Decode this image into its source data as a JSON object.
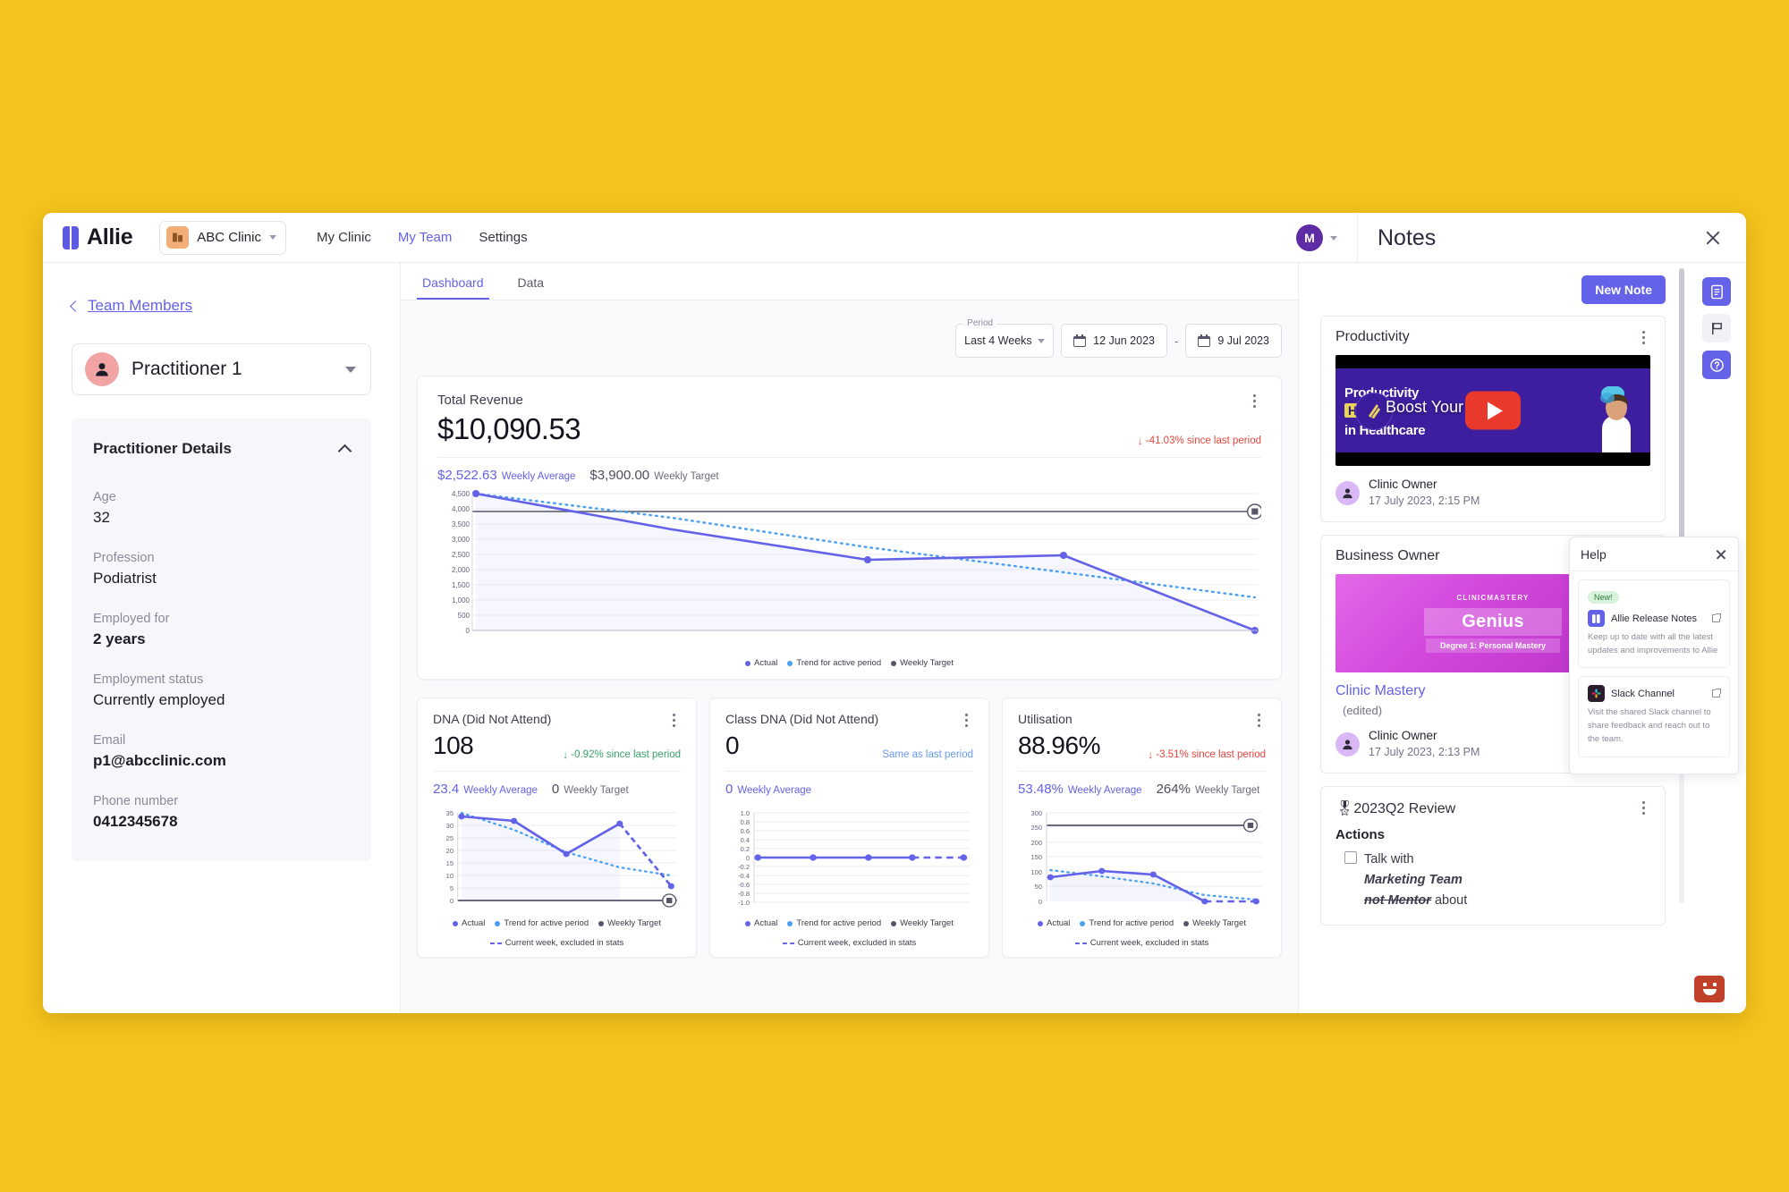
{
  "brand": {
    "name": "Allie",
    "accent": "#6462E8"
  },
  "topbar": {
    "clinic_name": "ABC Clinic",
    "nav": [
      {
        "label": "My Clinic",
        "active": false
      },
      {
        "label": "My Team",
        "active": true
      },
      {
        "label": "Settings",
        "active": false
      }
    ],
    "avatar_initial": "M"
  },
  "left_panel": {
    "breadcrumb": "Team Members",
    "practitioner": "Practitioner 1",
    "details_title": "Practitioner Details",
    "fields": [
      {
        "label": "Age",
        "value": "32",
        "bold": false
      },
      {
        "label": "Profession",
        "value": "Podiatrist",
        "bold": false
      },
      {
        "label": "Employed for",
        "value": "2 years",
        "bold": true
      },
      {
        "label": "Employment status",
        "value": "Currently employed",
        "bold": false
      },
      {
        "label": "Email",
        "value": "p1@abcclinic.com",
        "bold": true
      },
      {
        "label": "Phone number",
        "value": "0412345678",
        "bold": true
      }
    ]
  },
  "center": {
    "tabs": [
      {
        "label": "Dashboard",
        "active": true
      },
      {
        "label": "Data",
        "active": false
      }
    ],
    "period_legend": "Period",
    "period_value": "Last 4 Weeks",
    "date_from": "12 Jun 2023",
    "date_to": "9 Jul 2023",
    "date_sep": "-",
    "revenue": {
      "title": "Total Revenue",
      "value": "$10,090.53",
      "delta": "-41.03% since last period",
      "delta_dir": "down",
      "weekly_average_value": "$2,522.63",
      "weekly_average_label": "Weekly Average",
      "weekly_target_value": "$3,900.00",
      "weekly_target_label": "Weekly Target"
    },
    "cards": [
      {
        "title": "DNA (Did Not Attend)",
        "value": "108",
        "delta": "-0.92% since last period",
        "delta_dir": "good",
        "weekly_average_value": "23.4",
        "weekly_average_label": "Weekly Average",
        "weekly_target_value": "0",
        "weekly_target_label": "Weekly Target"
      },
      {
        "title": "Class DNA (Did Not Attend)",
        "value": "0",
        "delta": "Same as last period",
        "delta_dir": "same",
        "weekly_average_value": "0",
        "weekly_average_label": "Weekly Average",
        "weekly_target_value": "",
        "weekly_target_label": ""
      },
      {
        "title": "Utilisation",
        "value": "88.96%",
        "delta": "-3.51% since last period",
        "delta_dir": "down",
        "weekly_average_value": "53.48%",
        "weekly_average_label": "Weekly Average",
        "weekly_target_value": "264%",
        "weekly_target_label": "Weekly Target"
      }
    ],
    "legend": {
      "actual": "Actual",
      "trend": "Trend for active period",
      "target": "Weekly Target",
      "current_week": "Current week, excluded in stats"
    },
    "legend_colors": {
      "actual": "#6462E8",
      "trend": "#49A0F0",
      "target": "#55556A"
    }
  },
  "chart_data": [
    {
      "type": "line",
      "title": "Total Revenue",
      "ylabel": "",
      "xlabel": "",
      "ylim": [
        0,
        4500
      ],
      "yticks": [
        0,
        500,
        1000,
        1500,
        2000,
        2500,
        3000,
        3500,
        4000,
        4500
      ],
      "ytick_labels": [
        "0",
        "500",
        "1,000",
        "1,500",
        "2,000",
        "2,500",
        "3,000",
        "3,500",
        "4,000",
        "4,500"
      ],
      "grid": true,
      "legend_position": "bottom",
      "series": [
        {
          "name": "Actual",
          "style": "solid",
          "color": "#6462E8",
          "x": [
            0,
            1,
            2,
            3,
            4
          ],
          "values": [
            4470,
            3600,
            2735,
            2880,
            90
          ]
        },
        {
          "name": "Trend for active period",
          "style": "dotted",
          "color": "#49A0F0",
          "x": [
            0,
            1,
            2,
            3,
            4
          ],
          "values": [
            4470,
            3760,
            2790,
            2130,
            1320
          ]
        },
        {
          "name": "Weekly Target",
          "style": "solid-flat",
          "color": "#55556A",
          "x": [
            0,
            4
          ],
          "values": [
            3900,
            3900
          ]
        }
      ]
    },
    {
      "type": "line",
      "title": "DNA (Did Not Attend)",
      "ylim": [
        0,
        35
      ],
      "yticks": [
        0,
        5,
        10,
        15,
        20,
        25,
        30,
        35
      ],
      "ytick_labels": [
        "0",
        "5",
        "10",
        "15",
        "20",
        "25",
        "30",
        "35"
      ],
      "grid": true,
      "legend_position": "bottom",
      "series": [
        {
          "name": "Actual",
          "style": "solid",
          "color": "#6462E8",
          "x": [
            0,
            1,
            2,
            3
          ],
          "values": [
            32,
            30,
            17,
            29
          ]
        },
        {
          "name": "Current week, excluded in stats",
          "style": "dashed",
          "color": "#6462E8",
          "x": [
            3,
            4
          ],
          "values": [
            29,
            9
          ]
        },
        {
          "name": "Trend for active period",
          "style": "dotted",
          "color": "#49A0F0",
          "x": [
            0,
            1,
            2,
            3,
            4
          ],
          "values": [
            32,
            27.5,
            21.5,
            17,
            14
          ]
        },
        {
          "name": "Weekly Target",
          "style": "solid-flat",
          "color": "#55556A",
          "x": [
            0,
            4
          ],
          "values": [
            0,
            0
          ]
        }
      ]
    },
    {
      "type": "line",
      "title": "Class DNA (Did Not Attend)",
      "ylim": [
        -1.0,
        1.0
      ],
      "yticks": [
        -1.0,
        -0.8,
        -0.6,
        -0.4,
        -0.2,
        0,
        0.2,
        0.4,
        0.6,
        0.8,
        1.0
      ],
      "ytick_labels": [
        "-1.0",
        "-0.8",
        "-0.6",
        "-0.4",
        "-0.2",
        "0",
        "0.2",
        "0.4",
        "0.6",
        "0.8",
        "1.0"
      ],
      "grid": true,
      "legend_position": "bottom",
      "series": [
        {
          "name": "Actual",
          "style": "solid",
          "color": "#6462E8",
          "x": [
            0,
            1,
            2,
            3
          ],
          "values": [
            0,
            0,
            0,
            0
          ]
        },
        {
          "name": "Current week, excluded in stats",
          "style": "dashed",
          "color": "#6462E8",
          "x": [
            3,
            4
          ],
          "values": [
            0,
            0
          ]
        },
        {
          "name": "Trend for active period",
          "style": "dotted",
          "color": "#49A0F0",
          "x": [
            0,
            4
          ],
          "values": [
            0,
            0
          ]
        }
      ]
    },
    {
      "type": "line",
      "title": "Utilisation",
      "ylim": [
        0,
        300
      ],
      "yticks": [
        0,
        50,
        100,
        150,
        200,
        250,
        300
      ],
      "ytick_labels": [
        "0",
        "50",
        "100",
        "150",
        "200",
        "250",
        "300"
      ],
      "grid": true,
      "legend_position": "bottom",
      "series": [
        {
          "name": "Actual",
          "style": "solid",
          "color": "#6462E8",
          "x": [
            0,
            1,
            2,
            3
          ],
          "values": [
            78,
            99,
            87,
            0
          ]
        },
        {
          "name": "Current week, excluded in stats",
          "style": "dashed",
          "color": "#6462E8",
          "x": [
            3,
            4
          ],
          "values": [
            0,
            0
          ]
        },
        {
          "name": "Trend for active period",
          "style": "dotted",
          "color": "#49A0F0",
          "x": [
            0,
            1,
            2,
            3,
            4
          ],
          "values": [
            104,
            88,
            66,
            30,
            5
          ]
        },
        {
          "name": "Weekly Target",
          "style": "solid-flat",
          "color": "#55556A",
          "x": [
            0,
            4
          ],
          "values": [
            264,
            264
          ]
        }
      ]
    }
  ],
  "notes": {
    "title": "Notes",
    "new_note_label": "New Note",
    "items": [
      {
        "title": "Productivity",
        "kind": "video",
        "video_line1": "Productivity",
        "video_hacks": "Hacks",
        "video_line2": "in Healthcare",
        "video_overlay_title": "Boost Your Pr...",
        "author": "Clinic Owner",
        "timestamp": "17 July 2023, 2:15 PM"
      },
      {
        "title": "Business Owner",
        "kind": "link",
        "thumb_logo": "CLINICMASTERY",
        "thumb_heading": "Genius",
        "thumb_sub": "Degree 1: Personal Mastery",
        "link_text": "Clinic Mastery",
        "edited": "(edited)",
        "author": "Clinic Owner",
        "timestamp": "17 July 2023, 2:13 PM"
      },
      {
        "title": "2023Q2 Review",
        "title_emoji": "🎖",
        "kind": "checklist",
        "section": "Actions",
        "checklist": [
          {
            "plain_before": "Talk with",
            "bold": "Marketing Team",
            "struck": "not Mentor",
            "plain_after": "about",
            "checked": false
          }
        ]
      }
    ]
  },
  "help": {
    "title": "Help",
    "items": [
      {
        "badge": "New!",
        "name": "Allie Release Notes",
        "desc": "Keep up to date with all the latest updates and improvements to Allie",
        "icon": "allie-logo-icon"
      },
      {
        "badge": "",
        "name": "Slack Channel",
        "desc": "Visit the shared Slack channel to share feedback and reach out to the team.",
        "icon": "slack-icon"
      }
    ]
  }
}
